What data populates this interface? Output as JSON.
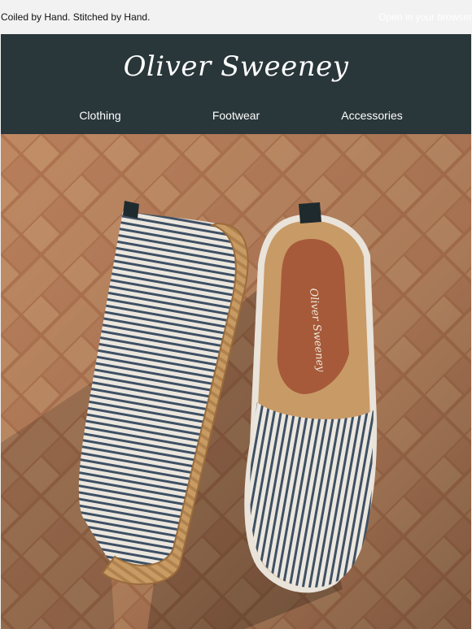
{
  "preheader": {
    "tagline": "Coiled by Hand. Stitched by Hand.",
    "browser_link": "Open in your browser"
  },
  "header": {
    "brand": "Oliver Sweeney",
    "nav": [
      "Clothing",
      "Footwear",
      "Accessories"
    ]
  },
  "hero": {
    "insole_brand": "Oliver Sweeney",
    "colors": {
      "brick_light": "#c68b63",
      "brick_dark": "#8d5637",
      "stripe_navy": "#3d4f64",
      "canvas": "#e9e3d9",
      "jute": "#c79a63",
      "header": "#29363a"
    }
  }
}
